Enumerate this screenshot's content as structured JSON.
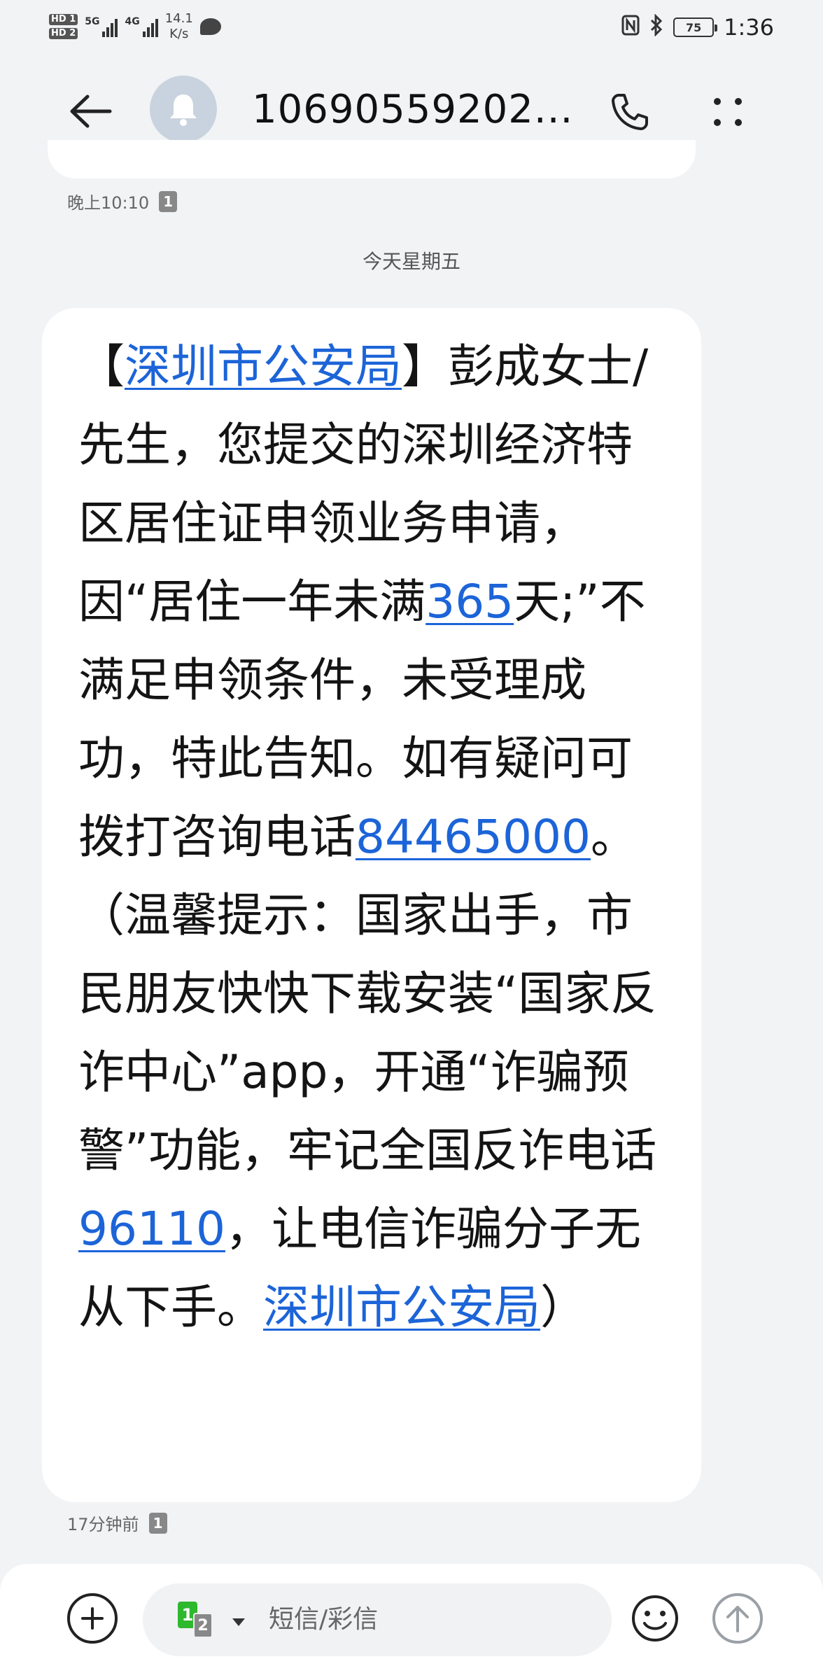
{
  "status_bar": {
    "hd1": "HD 1",
    "hd2": "HD 2",
    "sim1_net": "5G",
    "sim2_net": "4G",
    "net_speed_value": "14.1",
    "net_speed_unit": "K/s",
    "battery": "75",
    "time": "1:36"
  },
  "header": {
    "contact": "10690559202..."
  },
  "conversation": {
    "prev_time": "晚上10:10",
    "prev_sim": "1",
    "date_separator": "今天星期五",
    "message": {
      "seg1": "【",
      "link1": "深圳市公安局",
      "seg2": "】彭成女士/先生，您提交的深圳经济特区居住证申领业务申请，因“居住一年未满",
      "link2": "365",
      "seg3": "天;”不满足申领条件，未受理成功，特此告知。如有疑问可拨打咨询电话",
      "link3": "84465000",
      "seg4": "。（温馨提示：国家出手，市民朋友快快下载安装“国家反诈中心”app，开通“诈骗预警”功能，牢记全国反诈电话",
      "link4": "96110",
      "seg5": "，让电信诈骗分子无从下手。",
      "link5": "深圳市公安局",
      "seg6": "）"
    },
    "msg_time": "17分钟前",
    "msg_sim": "1"
  },
  "input_bar": {
    "sim_primary": "1",
    "sim_secondary": "2",
    "placeholder": "短信/彩信"
  },
  "colors": {
    "link": "#1c64d8",
    "background": "#f1f3f5",
    "bubble": "#ffffff",
    "sim1_green": "#2eb82e"
  }
}
